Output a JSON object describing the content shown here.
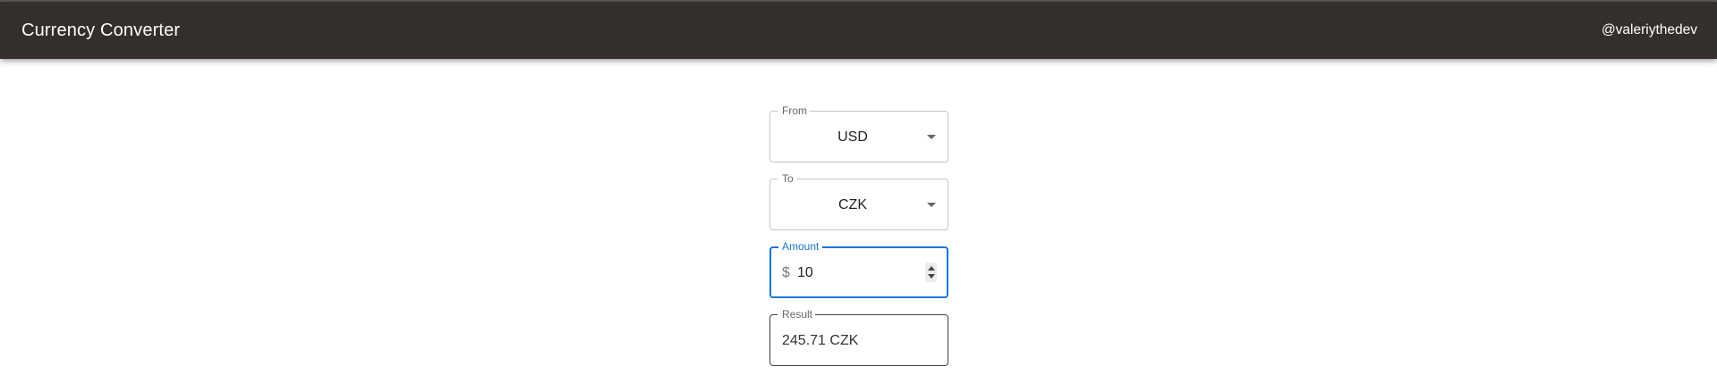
{
  "app": {
    "title": "Currency Converter",
    "handle": "@valeriythedev"
  },
  "form": {
    "from": {
      "label": "From",
      "value": "USD"
    },
    "to": {
      "label": "To",
      "value": "CZK"
    },
    "amount": {
      "label": "Amount",
      "prefix": "$",
      "value": "10"
    },
    "result": {
      "label": "Result",
      "value": "245.71 CZK"
    }
  },
  "colors": {
    "appbar": "#342f2d",
    "focus": "#1976d2"
  },
  "icons": {
    "select_arrow": "caret-down-icon",
    "stepper": "number-stepper-icon"
  }
}
